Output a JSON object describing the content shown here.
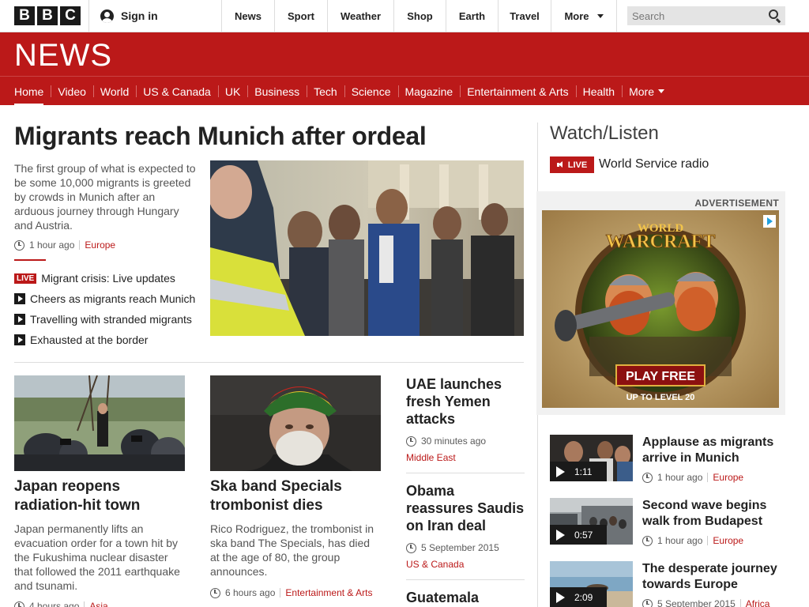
{
  "masthead": {
    "logo_letters": [
      "B",
      "B",
      "C"
    ],
    "signin_label": "Sign in",
    "nav": [
      {
        "label": "News"
      },
      {
        "label": "Sport"
      },
      {
        "label": "Weather"
      },
      {
        "label": "Shop"
      },
      {
        "label": "Earth"
      },
      {
        "label": "Travel"
      },
      {
        "label": "More"
      }
    ],
    "search_placeholder": "Search"
  },
  "news_header": {
    "logo_text": "NEWS",
    "sections": [
      {
        "label": "Home",
        "active": true
      },
      {
        "label": "Video"
      },
      {
        "label": "World"
      },
      {
        "label": "US & Canada"
      },
      {
        "label": "UK"
      },
      {
        "label": "Business"
      },
      {
        "label": "Tech"
      },
      {
        "label": "Science"
      },
      {
        "label": "Magazine"
      },
      {
        "label": "Entertainment & Arts"
      },
      {
        "label": "Health"
      },
      {
        "label": "More"
      }
    ]
  },
  "top_story": {
    "headline": "Migrants reach Munich after ordeal",
    "summary": "The first group of what is expected to be some 10,000 migrants is greeted by crowds in Munich after an arduous journey through Hungary and Austria.",
    "time": "1 hour ago",
    "category": "Europe",
    "related": [
      {
        "type": "live",
        "tag": "LIVE",
        "label": "Migrant crisis: Live updates"
      },
      {
        "type": "video",
        "label": "Cheers as migrants reach Munich"
      },
      {
        "type": "video",
        "label": "Travelling with stranded migrants"
      },
      {
        "type": "video",
        "label": "Exhausted at the border"
      }
    ]
  },
  "cards": [
    {
      "title": "Japan reopens radiation-hit town",
      "summary": "Japan permanently lifts an evacuation order for a town hit by the Fukushima nuclear disaster that followed the 2011 earthquake and tsunami.",
      "time": "4 hours ago",
      "category": "Asia"
    },
    {
      "title": "Ska band Specials trombonist dies",
      "summary": "Rico Rodriguez, the trombonist in ska band The Specials, has died at the age of 80, the group announces.",
      "time": "6 hours ago",
      "category": "Entertainment & Arts"
    }
  ],
  "text_stories": [
    {
      "title": "UAE launches fresh Yemen attacks",
      "time": "30 minutes ago",
      "category": "Middle East"
    },
    {
      "title": "Obama reassures Saudis on Iran deal",
      "time": "5 September 2015",
      "category": "US & Canada"
    },
    {
      "title": "Guatemala"
    }
  ],
  "watch_listen": {
    "title": "Watch/Listen",
    "live_label": "LIVE",
    "radio_label": "World Service radio",
    "ad_label": "ADVERTISEMENT",
    "ad_logo_top": "WORLD",
    "ad_logo_brand": "WARCRAFT",
    "ad_cta": "PLAY FREE",
    "ad_sub": "UP TO LEVEL 20",
    "videos": [
      {
        "title": "Applause as migrants arrive in Munich",
        "duration": "1:11",
        "time": "1 hour ago",
        "category": "Europe"
      },
      {
        "title": "Second wave begins walk from Budapest",
        "duration": "0:57",
        "time": "1 hour ago",
        "category": "Europe"
      },
      {
        "title": "The desperate journey towards Europe",
        "duration": "2:09",
        "time": "5 September 2015",
        "category": "Africa"
      }
    ]
  }
}
